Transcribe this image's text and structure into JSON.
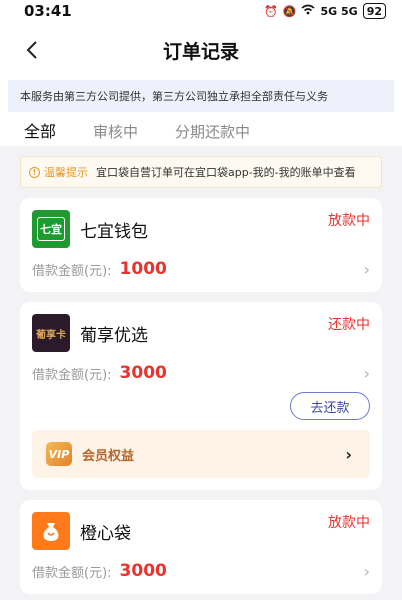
{
  "status_bar": {
    "time": "03:41",
    "signal": "5G 5G",
    "battery": "92"
  },
  "header": {
    "title": "订单记录"
  },
  "notice": {
    "text": "本服务由第三方公司提供，第三方公司独立承担全部责任与义务"
  },
  "tabs": [
    {
      "label": "全部",
      "active": true
    },
    {
      "label": "审核中",
      "active": false
    },
    {
      "label": "分期还款中",
      "active": false
    }
  ],
  "tip": {
    "label": "温馨提示",
    "text": "宜口袋自营订单可在宜口袋app-我的-我的账单中查看"
  },
  "orders": [
    {
      "name": "七宜钱包",
      "logo_text": "七宜",
      "status": "放款中",
      "amount_label": "借款金额(元):",
      "amount": "1000"
    },
    {
      "name": "葡享优选",
      "logo_text": "葡享卡",
      "status": "还款中",
      "amount_label": "借款金额(元):",
      "amount": "3000",
      "repay_button": "去还款",
      "vip_label": "会员权益",
      "vip_icon_text": "VIP"
    },
    {
      "name": "橙心袋",
      "status": "放款中",
      "amount_label": "借款金额(元):",
      "amount": "3000"
    }
  ],
  "colors": {
    "accent_red": "#e8332e",
    "tab_indicator": "#f03a3a",
    "notice_bg": "#eef0fb",
    "tip_orange": "#e39a2b"
  }
}
